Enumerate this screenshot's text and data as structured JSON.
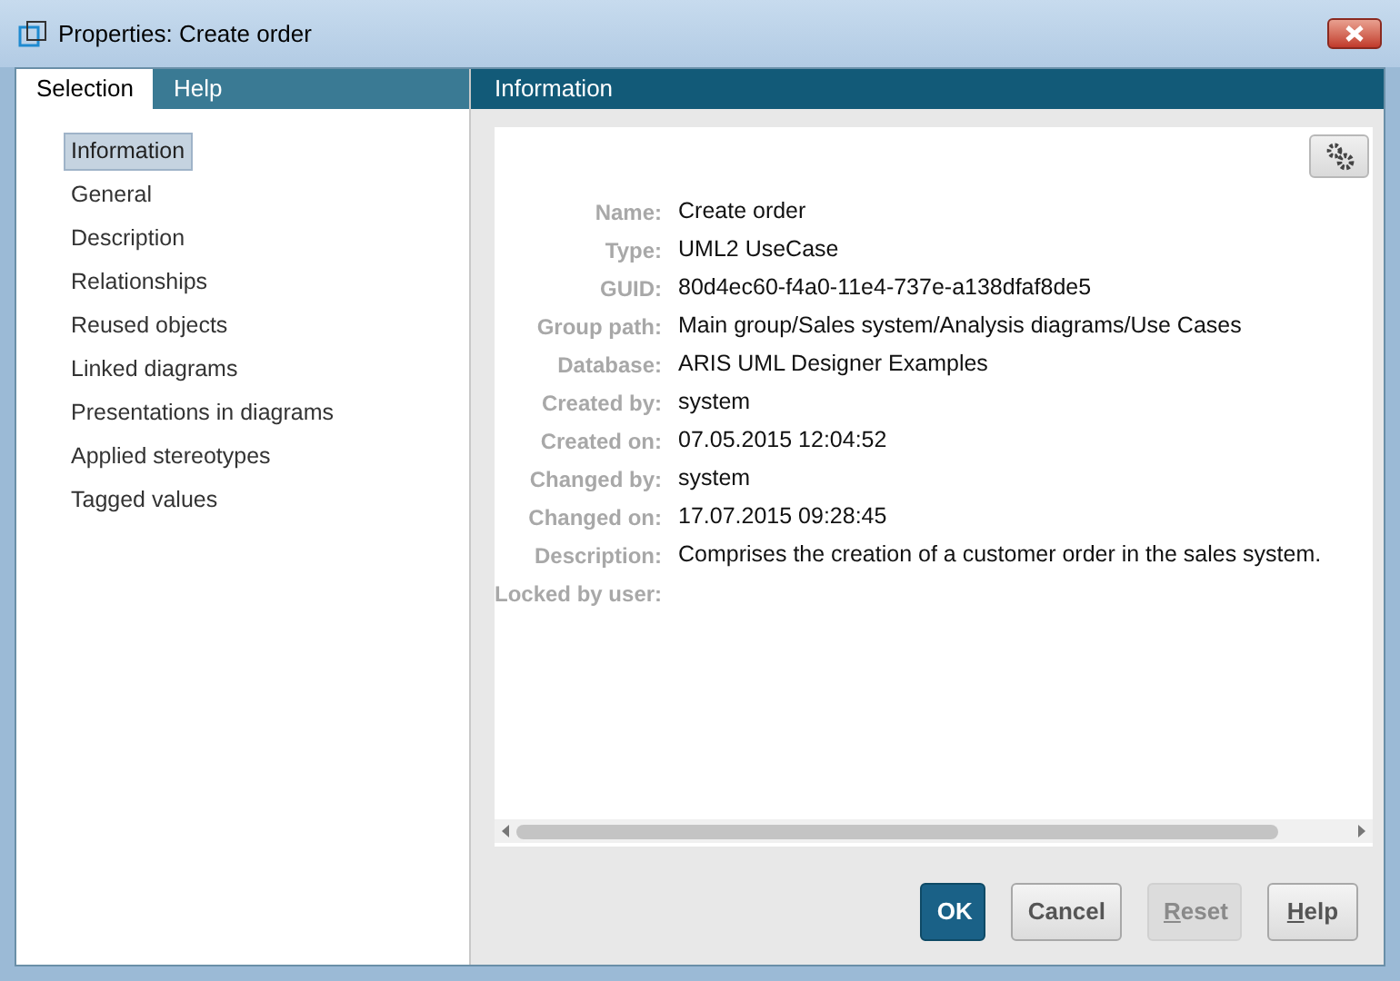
{
  "window": {
    "title": "Properties: Create order"
  },
  "tabs": [
    {
      "label": "Selection",
      "selected": true
    },
    {
      "label": "Help",
      "selected": false
    }
  ],
  "nav_items": [
    {
      "label": "Information",
      "selected": true
    },
    {
      "label": "General",
      "selected": false
    },
    {
      "label": "Description",
      "selected": false
    },
    {
      "label": "Relationships",
      "selected": false
    },
    {
      "label": "Reused objects",
      "selected": false
    },
    {
      "label": "Linked diagrams",
      "selected": false
    },
    {
      "label": "Presentations in diagrams",
      "selected": false
    },
    {
      "label": "Applied stereotypes",
      "selected": false
    },
    {
      "label": "Tagged values",
      "selected": false
    }
  ],
  "panel": {
    "title": "Information",
    "fields": [
      {
        "label": "Name:",
        "value": "Create order"
      },
      {
        "label": "Type:",
        "value": "UML2 UseCase"
      },
      {
        "label": "GUID:",
        "value": "80d4ec60-f4a0-11e4-737e-a138dfaf8de5"
      },
      {
        "label": "Group path:",
        "value": "Main group/Sales system/Analysis diagrams/Use Cases"
      },
      {
        "label": "Database:",
        "value": "ARIS UML Designer Examples"
      },
      {
        "label": "Created by:",
        "value": "system"
      },
      {
        "label": "Created on:",
        "value": "07.05.2015 12:04:52"
      },
      {
        "label": "Changed by:",
        "value": "system"
      },
      {
        "label": "Changed on:",
        "value": "17.07.2015 09:28:45"
      },
      {
        "label": "Description:",
        "value": "Comprises the creation of a customer order in the sales system."
      },
      {
        "label": "Locked by user:"
      }
    ]
  },
  "buttons": [
    {
      "label": "OK",
      "kind": "primary",
      "disabled": false,
      "mnemonic": false
    },
    {
      "label": "Cancel",
      "kind": "default",
      "disabled": false,
      "mnemonic": false
    },
    {
      "label": "Reset",
      "kind": "default",
      "disabled": true,
      "mnemonic": true
    },
    {
      "label": "Help",
      "kind": "default",
      "disabled": false,
      "mnemonic": true
    }
  ]
}
